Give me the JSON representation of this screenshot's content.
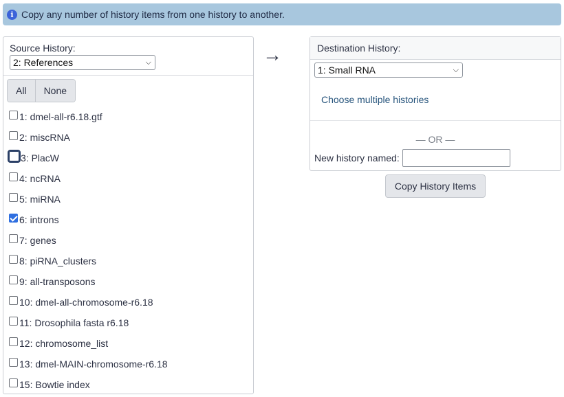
{
  "info": {
    "icon": "info-icon",
    "icon_glyph": "i",
    "message": "Copy any number of history items from one history to another."
  },
  "source": {
    "title": "Source History:",
    "selected": "2: References",
    "buttons": {
      "all": "All",
      "none": "None"
    },
    "items": [
      {
        "label": "1: dmel-all-r6.18.gtf",
        "checked": false,
        "focused": false
      },
      {
        "label": "2: miscRNA",
        "checked": false,
        "focused": false
      },
      {
        "label": "3: PlacW",
        "checked": false,
        "focused": true
      },
      {
        "label": "4: ncRNA",
        "checked": false,
        "focused": false
      },
      {
        "label": "5: miRNA",
        "checked": false,
        "focused": false
      },
      {
        "label": "6: introns",
        "checked": true,
        "focused": false
      },
      {
        "label": "7: genes",
        "checked": false,
        "focused": false
      },
      {
        "label": "8: piRNA_clusters",
        "checked": false,
        "focused": false
      },
      {
        "label": "9: all-transposons",
        "checked": false,
        "focused": false
      },
      {
        "label": "10: dmel-all-chromosome-r6.18",
        "checked": false,
        "focused": false
      },
      {
        "label": "11: Drosophila fasta r6.18",
        "checked": false,
        "focused": false
      },
      {
        "label": "12: chromosome_list",
        "checked": false,
        "focused": false
      },
      {
        "label": "13: dmel-MAIN-chromosome-r6.18",
        "checked": false,
        "focused": false
      },
      {
        "label": "15: Bowtie index",
        "checked": false,
        "focused": false
      }
    ]
  },
  "arrow_glyph": "→",
  "destination": {
    "title": "Destination History:",
    "selected": "1: Small RNA",
    "multiple_link": "Choose multiple histories",
    "or_text": "— OR —",
    "new_history_label": "New history named:",
    "new_history_value": ""
  },
  "copy_button": "Copy History Items",
  "colors": {
    "info_bg": "#a8c7de",
    "link": "#25537b",
    "checkbox_checked": "#2f6fe0"
  }
}
